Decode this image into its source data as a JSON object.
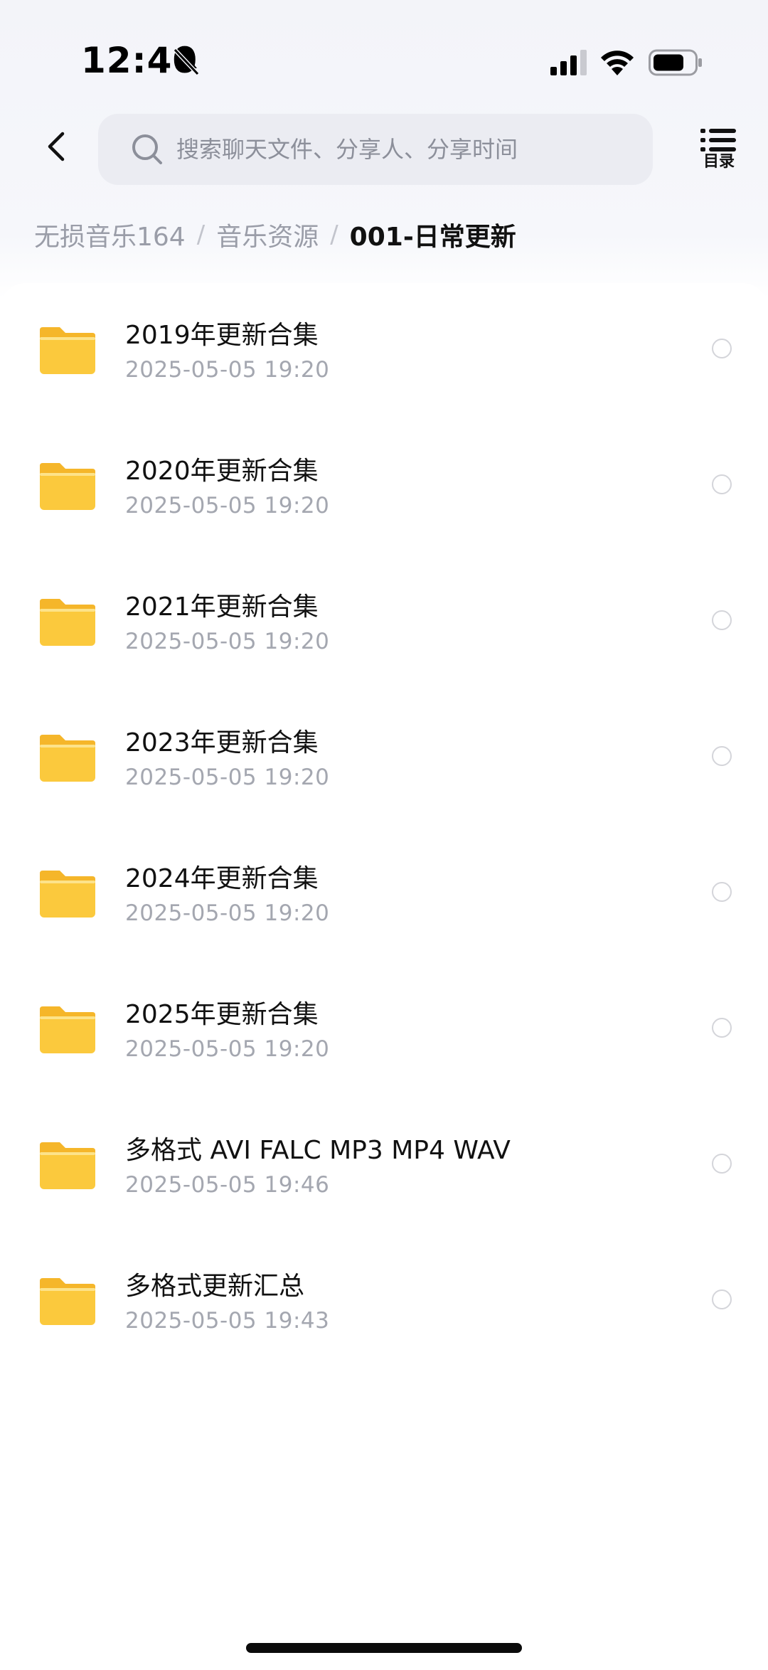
{
  "status_bar": {
    "time": "12:40",
    "icons": [
      "bell-slash-icon",
      "signal-icon",
      "wifi-icon",
      "battery-icon"
    ]
  },
  "header": {
    "back_icon": "chevron-left-icon",
    "search_placeholder": "搜索聊天文件、分享人、分享时间",
    "directory_label": "目录",
    "directory_icon": "list-icon"
  },
  "breadcrumb": {
    "items": [
      "无损音乐164",
      "音乐资源",
      "001-日常更新"
    ]
  },
  "files": [
    {
      "name": "2019年更新合集",
      "time": "2025-05-05 19:20",
      "icon": "folder-icon"
    },
    {
      "name": "2020年更新合集",
      "time": "2025-05-05 19:20",
      "icon": "folder-icon"
    },
    {
      "name": "2021年更新合集",
      "time": "2025-05-05 19:20",
      "icon": "folder-icon"
    },
    {
      "name": "2023年更新合集",
      "time": "2025-05-05 19:20",
      "icon": "folder-icon"
    },
    {
      "name": "2024年更新合集",
      "time": "2025-05-05 19:20",
      "icon": "folder-icon"
    },
    {
      "name": "2025年更新合集",
      "time": "2025-05-05 19:20",
      "icon": "folder-icon"
    },
    {
      "name": "多格式 AVI FALC MP3 MP4 WAV",
      "time": "2025-05-05 19:46",
      "icon": "folder-icon"
    },
    {
      "name": "多格式更新汇总",
      "time": "2025-05-05 19:43",
      "icon": "folder-icon"
    }
  ],
  "colors": {
    "folder": "#fbc93d",
    "folder_tab": "#f5b62a",
    "accent_text": "#111111",
    "muted_text": "#a4a7b0"
  }
}
